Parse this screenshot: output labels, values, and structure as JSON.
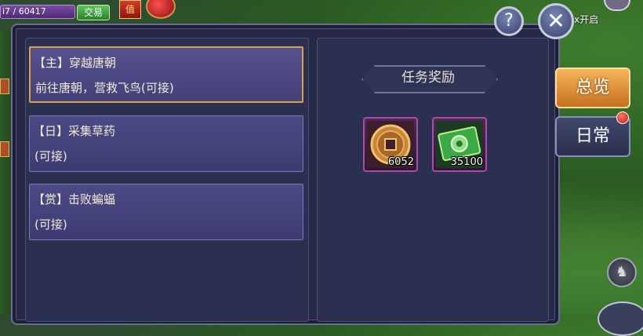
{
  "hud": {
    "exp_text": "i7 / 60417",
    "button_label": "交易",
    "badge_label": "值",
    "side_text": "x开启"
  },
  "quests": [
    {
      "title": "【主】穿越唐朝",
      "desc": "前往唐朝，营救飞鸟(可接)",
      "selected": true
    },
    {
      "title": "【日】采集草药",
      "desc": "(可接)",
      "selected": false
    },
    {
      "title": "【赏】击败蝙蝠",
      "desc": "(可接)",
      "selected": false
    }
  ],
  "rewards": {
    "title": "任务奖励",
    "items": [
      {
        "icon": "copper-coin-icon",
        "quantity": "6052"
      },
      {
        "icon": "banknote-icon",
        "quantity": "35100"
      }
    ]
  },
  "buttons": {
    "help_glyph": "?",
    "close_glyph": "✕",
    "horse_glyph": "♞"
  },
  "tabs": {
    "overview": "总览",
    "daily": "日常"
  },
  "colors": {
    "selected_border": "#d6a24b",
    "item_border": "#b04aa6",
    "tab_active": "#e89a3c"
  }
}
